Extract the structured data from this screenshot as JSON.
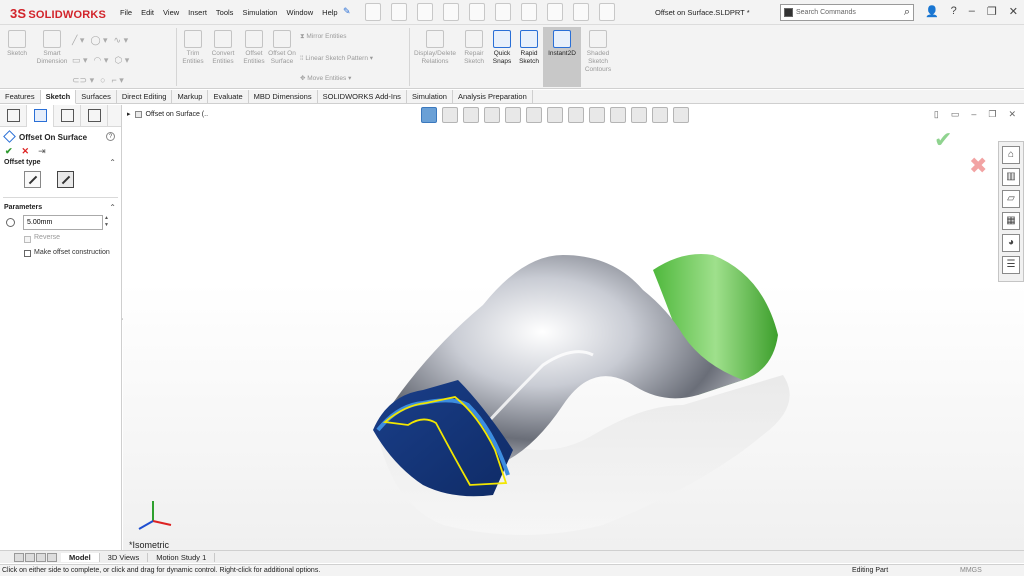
{
  "app": {
    "logo_text": "SOLIDWORKS",
    "logo_prefix": "3S"
  },
  "menu": [
    "File",
    "Edit",
    "View",
    "Insert",
    "Tools",
    "Simulation",
    "Window",
    "Help"
  ],
  "document": {
    "title": "Offset on Surface.SLDPRT *"
  },
  "search": {
    "placeholder": "Search Commands"
  },
  "ribbon": {
    "sketch": "Sketch",
    "smart_dimension": "Smart Dimension",
    "trim_entities": "Trim Entities",
    "convert_entities": "Convert Entities",
    "offset_entities": "Offset Entities",
    "offset_on_surface": "Offset On Surface",
    "mirror_entities": "Mirror Entities",
    "linear_sketch_pattern": "Linear Sketch Pattern",
    "move_entities": "Move Entities",
    "display_delete_relations": "Display/Delete Relations",
    "repair_sketch": "Repair Sketch",
    "quick_snaps": "Quick Snaps",
    "rapid_sketch": "Rapid Sketch",
    "instant2d": "Instant2D",
    "shaded_sketch_contours": "Shaded Sketch Contours"
  },
  "tabs": [
    "Features",
    "Sketch",
    "Surfaces",
    "Direct Editing",
    "Markup",
    "Evaluate",
    "MBD Dimensions",
    "SOLIDWORKS Add-Ins",
    "Simulation",
    "Analysis Preparation"
  ],
  "active_tab": "Sketch",
  "property_manager": {
    "title": "Offset On Surface",
    "offset_type_label": "Offset type",
    "parameters_label": "Parameters",
    "offset_value": "5.00mm",
    "reverse_label": "Reverse",
    "construction_label": "Make offset construction"
  },
  "graphics": {
    "breadcrumb": "Offset on Surface  (..",
    "view_label": "*Isometric",
    "colors": {
      "green_face": "#5cc24a",
      "blue_face": "#1e4c9e",
      "highlight": "#f2e600"
    }
  },
  "bottom_tabs": [
    "Model",
    "3D Views",
    "Motion Study 1"
  ],
  "status": {
    "message": "Click on either side to complete, or click and drag for dynamic control.  Right-click for additional options.",
    "mode": "Editing Part",
    "units": "MMGS"
  }
}
